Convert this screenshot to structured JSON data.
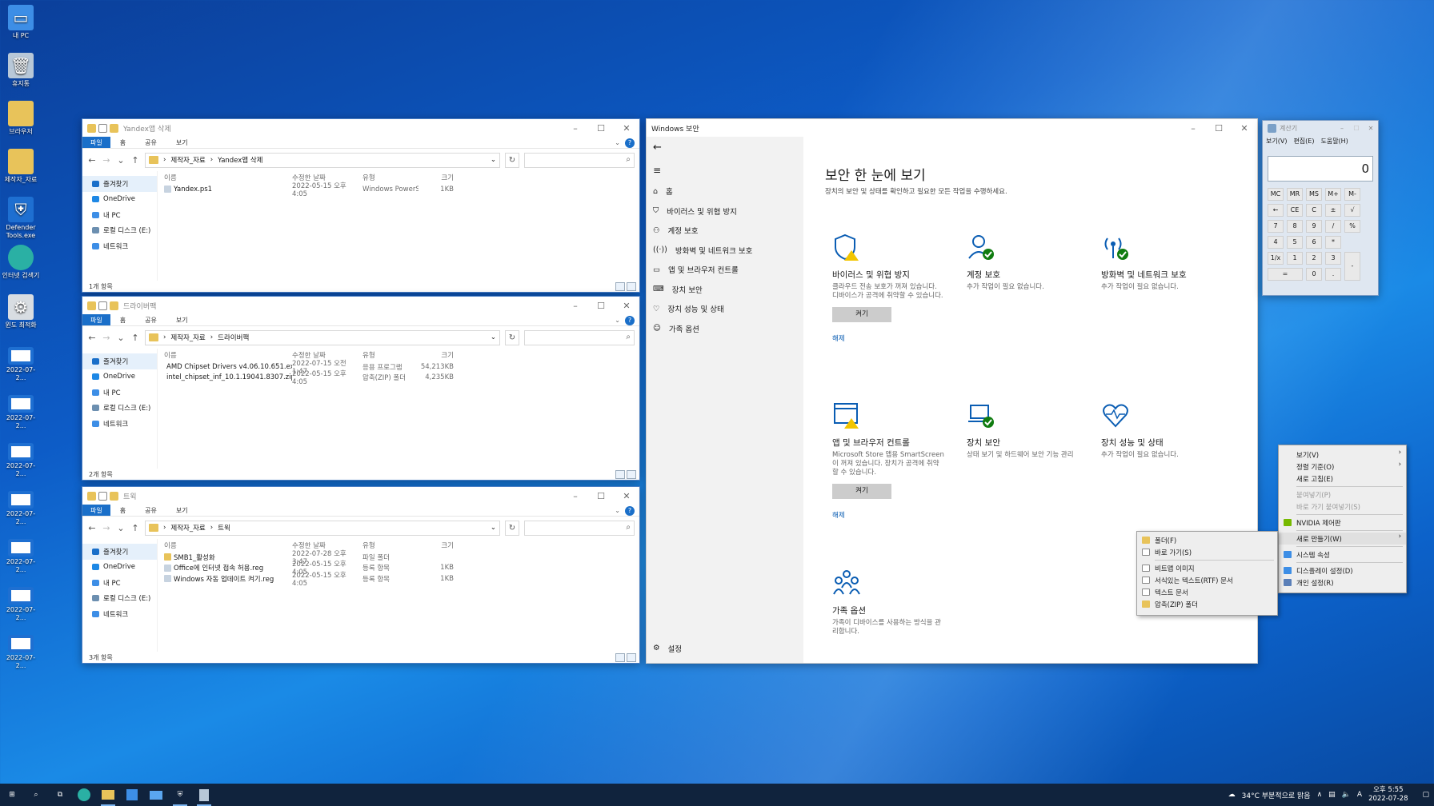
{
  "desktop_icons": [
    "내 PC",
    "휴지통",
    "브라우저",
    "제작자_자료",
    "Defender Tools.exe",
    "인터넷 검색기",
    "윈도 최적화",
    "2022-07-2...",
    "2022-07-2...",
    "2022-07-2...",
    "2022-07-2...",
    "2022-07-2...",
    "2022-07-2...",
    "2022-07-2..."
  ],
  "explorer_common": {
    "ribbon": [
      "파일",
      "홈",
      "공유",
      "보기"
    ],
    "columns": [
      "이름",
      "수정한 날짜",
      "유형",
      "크기"
    ],
    "nav": [
      "즐겨찾기",
      "OneDrive",
      "내 PC",
      "로컬 디스크 (E:)",
      "네트워크"
    ]
  },
  "explorer1": {
    "title": "Yandex앱 삭제",
    "path": [
      "제작자_자료",
      "Yandex앱 삭제"
    ],
    "files": [
      {
        "name": "Yandex.ps1",
        "date": "2022-05-15 오후 4:05",
        "type": "Windows PowerS...",
        "size": "1KB"
      }
    ],
    "status": "1개 항목"
  },
  "explorer2": {
    "title": "드라이버팩",
    "path": [
      "제작자_자료",
      "드라이버팩"
    ],
    "files": [
      {
        "name": "AMD Chipset Drivers v4.06.10.651.exe",
        "date": "2022-07-15 오전 1:47",
        "type": "응용 프로그램",
        "size": "54,213KB"
      },
      {
        "name": "intel_chipset_inf_10.1.19041.8307.zip",
        "date": "2022-05-15 오후 4:05",
        "type": "압축(ZIP) 폴더",
        "size": "4,235KB"
      }
    ],
    "status": "2개 항목"
  },
  "explorer3": {
    "title": "트윅",
    "path": [
      "제작자_자료",
      "트윅"
    ],
    "files": [
      {
        "name": "SMB1_활성화",
        "date": "2022-07-28 오후 3:47",
        "type": "파일 폴더",
        "size": ""
      },
      {
        "name": "Office에 인터넷 접속 허용.reg",
        "date": "2022-05-15 오후 4:05",
        "type": "등록 항목",
        "size": "1KB"
      },
      {
        "name": "Windows 자동 업데이트 켜기.reg",
        "date": "2022-05-15 오후 4:05",
        "type": "등록 항목",
        "size": "1KB"
      }
    ],
    "status": "3개 항목"
  },
  "security": {
    "title": "Windows 보안",
    "nav": [
      "홈",
      "바이러스 및 위협 방지",
      "계정 보호",
      "방화벽 및 네트워크 보호",
      "앱 및 브라우저 컨트롤",
      "장치 보안",
      "장치 성능 및 상태",
      "가족 옵션"
    ],
    "settings": "설정",
    "heading": "보안 한 눈에 보기",
    "subheading": "장치의 보안 및 상태를 확인하고 필요한 모든 작업을 수행하세요.",
    "cards": [
      {
        "title": "바이러스 및 위협 방지",
        "desc": "클라우드 전송 보호가 꺼져 있습니다. 디바이스가 공격에 취약할 수 있습니다.",
        "button": "켜기",
        "link": "해제"
      },
      {
        "title": "계정 보호",
        "desc": "추가 작업이 필요 없습니다."
      },
      {
        "title": "방화벽 및 네트워크 보호",
        "desc": "추가 작업이 필요 없습니다."
      },
      {
        "title": "앱 및 브라우저 컨트롤",
        "desc": "Microsoft Store 앱용 SmartScreen이 꺼져 있습니다. 장치가 공격에 취약할 수 있습니다.",
        "button": "켜기",
        "link": "해제"
      },
      {
        "title": "장치 보안",
        "desc": "상태 보기 및 하드웨어 보안 기능 관리"
      },
      {
        "title": "장치 성능 및 상태",
        "desc": "추가 작업이 필요 없습니다."
      },
      {
        "title": "가족 옵션",
        "desc": "가족이 디바이스를 사용하는 방식을 관리합니다."
      }
    ]
  },
  "calculator": {
    "title": "계산기",
    "menu": [
      "보기(V)",
      "편집(E)",
      "도움말(H)"
    ],
    "display": "0",
    "keys": [
      "MC",
      "MR",
      "MS",
      "M+",
      "M-",
      "←",
      "CE",
      "C",
      "±",
      "√",
      "7",
      "8",
      "9",
      "/",
      "%",
      "4",
      "5",
      "6",
      "*",
      "1/x",
      "1",
      "2",
      "3",
      "-",
      "=",
      "0",
      ".",
      "+"
    ]
  },
  "context_menu": {
    "items": [
      "보기(V)",
      "정렬 기준(O)",
      "새로 고침(E)",
      "붙여넣기(P)",
      "바로 가기 붙여넣기(S)",
      "NVIDIA 제어판",
      "새로 만들기(W)",
      "시스템 속성",
      "디스플레이 설정(D)",
      "개인 설정(R)"
    ]
  },
  "submenu": {
    "items": [
      "폴더(F)",
      "바로 가기(S)",
      "비트맵 이미지",
      "서식있는 텍스트(RTF) 문서",
      "텍스트 문서",
      "압축(ZIP) 폴더"
    ]
  },
  "taskbar": {
    "weather": "34°C 부분적으로 맑음",
    "ime": "A",
    "time": "오후 5:55",
    "date": "2022-07-28"
  }
}
